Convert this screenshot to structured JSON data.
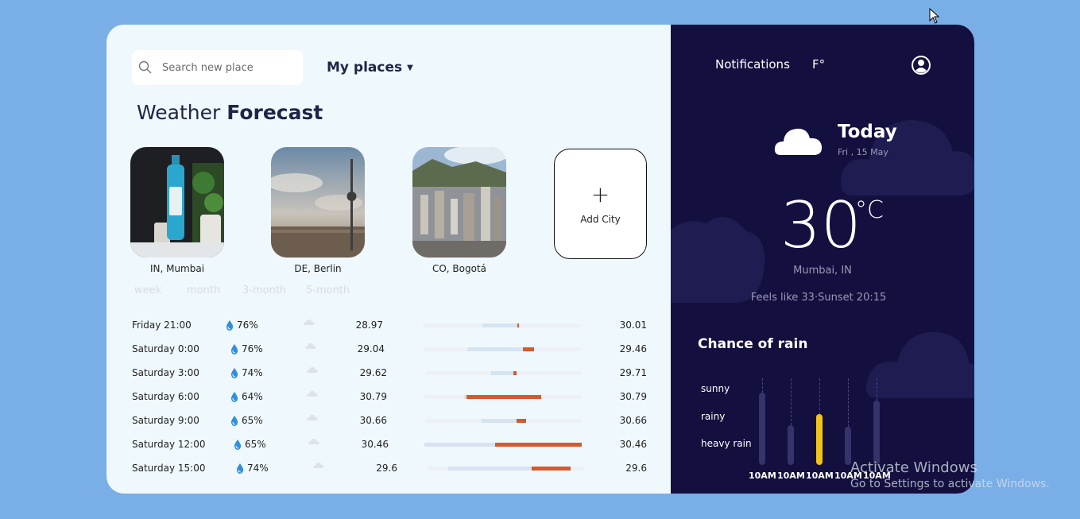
{
  "search": {
    "placeholder": "Search new place"
  },
  "nav": {
    "my_places": "My places",
    "caret": "▼"
  },
  "title": {
    "light": "Weather",
    "bold": "Forecast"
  },
  "cities": [
    {
      "label": "IN, Mumbai"
    },
    {
      "label": "DE, Berlin"
    },
    {
      "label": "CO, Bogotá"
    }
  ],
  "add_city": {
    "plus": "+",
    "label": "Add City"
  },
  "ranges": [
    "week",
    "month",
    "3-month",
    "5-month"
  ],
  "forecast": [
    {
      "time": "Friday 21:00",
      "rain": "76%",
      "low": "28.97",
      "high": "30.01",
      "blue": [
        0.38,
        0.6
      ],
      "orange": [
        0.6,
        0.61
      ]
    },
    {
      "time": "Saturday 0:00",
      "rain": "76%",
      "low": "29.04",
      "high": "29.46",
      "blue": [
        0.28,
        0.63
      ],
      "orange": [
        0.63,
        0.7
      ]
    },
    {
      "time": "Saturday 3:00",
      "rain": "74%",
      "low": "29.62",
      "high": "29.71",
      "blue": [
        0.42,
        0.56
      ],
      "orange": [
        0.56,
        0.58
      ]
    },
    {
      "time": "Saturday 6:00",
      "rain": "64%",
      "low": "30.79",
      "high": "30.79",
      "blue": [
        0.25,
        0.27
      ],
      "orange": [
        0.27,
        0.74
      ]
    },
    {
      "time": "Saturday 9:00",
      "rain": "65%",
      "low": "30.66",
      "high": "30.66",
      "blue": [
        0.36,
        0.58
      ],
      "orange": [
        0.58,
        0.64
      ]
    },
    {
      "time": "Saturday 12:00",
      "rain": "65%",
      "low": "30.46",
      "high": "30.46",
      "blue": [
        0.0,
        0.45
      ],
      "orange": [
        0.45,
        1.0
      ]
    },
    {
      "time": "Saturday 15:00",
      "rain": "74%",
      "low": "29.6",
      "high": "29.6",
      "blue": [
        0.13,
        0.66
      ],
      "orange": [
        0.66,
        0.91
      ]
    }
  ],
  "top": {
    "notifications": "Notifications",
    "unit": "F°"
  },
  "today": {
    "label": "Today",
    "date": "Fri , 15 May",
    "temp": "30",
    "unit": "°C",
    "location": "Mumbai, IN",
    "feels": "Feels like 33·Sunset 20:15"
  },
  "rain_chart": {
    "title": "Chance of rain",
    "levels": [
      "sunny",
      "rainy",
      "heavy rain"
    ],
    "times": [
      "10AM",
      "10AM",
      "10AM",
      "10AM",
      "10AM"
    ],
    "values": [
      0.87,
      0.48,
      0.61,
      0.46,
      0.77
    ],
    "highlight_index": 2,
    "colors": {
      "bar": "#36326a",
      "highlight": "#f2c31a"
    }
  },
  "watermark": {
    "line1": "Activate Windows",
    "line2": "Go to Settings to activate Windows."
  }
}
